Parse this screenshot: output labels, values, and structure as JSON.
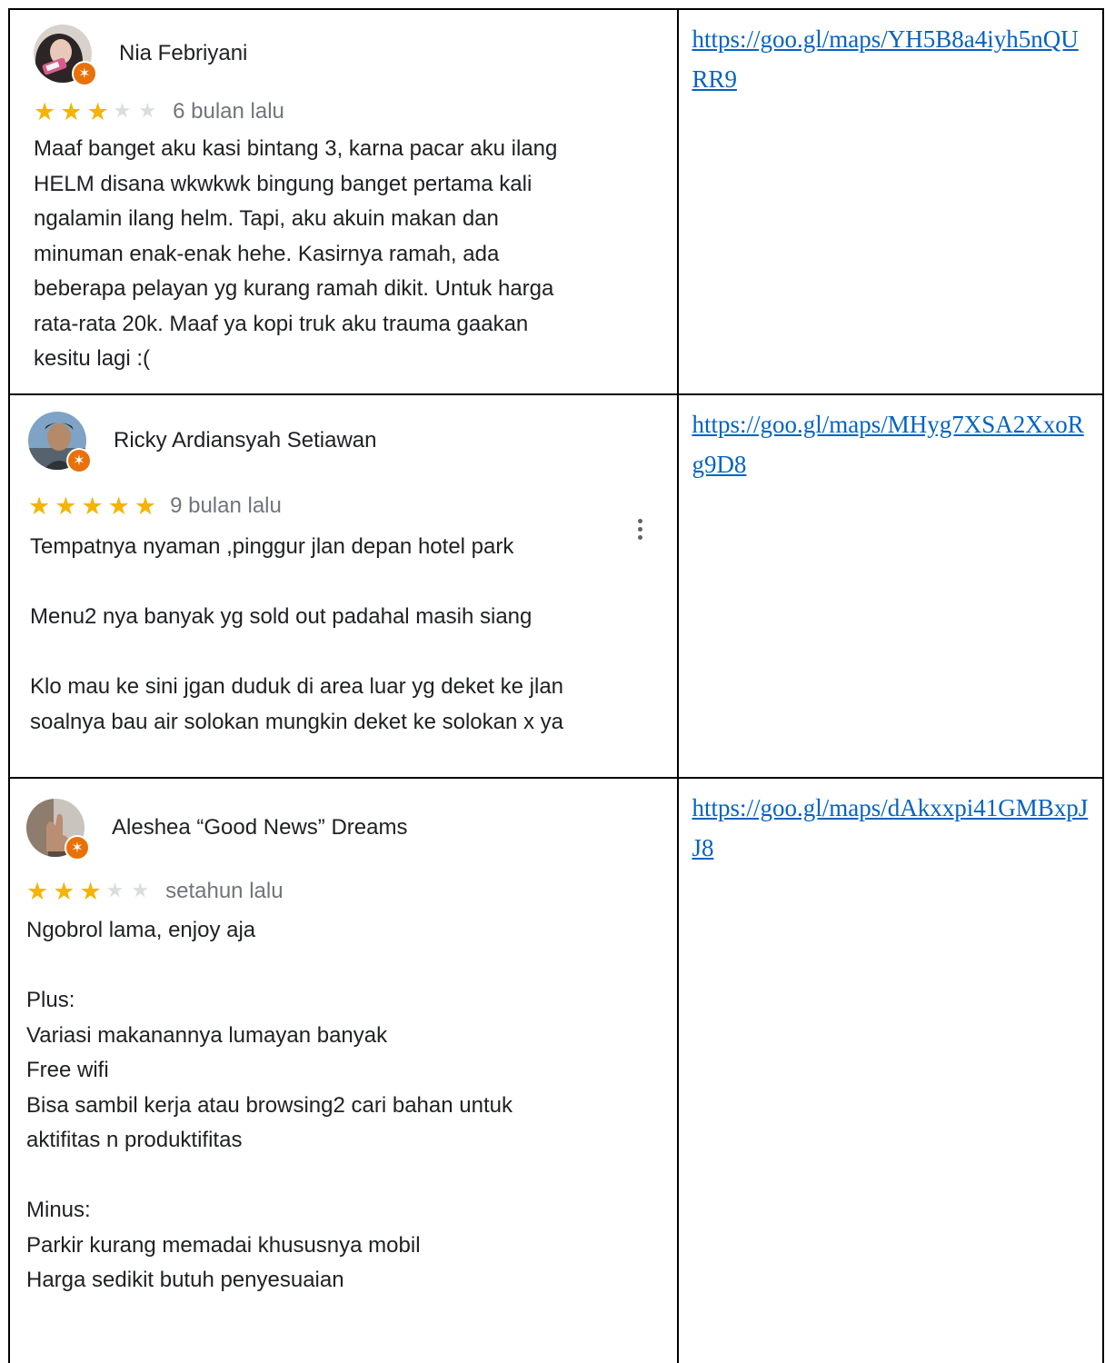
{
  "reviews": [
    {
      "name": "Nia Febriyani",
      "stars": 3,
      "date": "6 bulan lalu",
      "text": "Maaf banget aku kasi bintang 3, karna pacar aku ilang\nHELM disana wkwkwk bingung banget pertama kali\nngalamin ilang helm. Tapi, aku akuin makan dan\nminuman enak-enak hehe. Kasirnya ramah, ada\nbeberapa pelayan yg kurang ramah dikit. Untuk harga\nrata-rata 20k. Maaf ya kopi truk aku trauma gaakan\nkesitu lagi :(",
      "link": "https://goo.gl/maps/YH5B8a4iyh5nQURR9"
    },
    {
      "name": "Ricky Ardiansyah Setiawan",
      "stars": 5,
      "date": "9 bulan lalu",
      "text": "Tempatnya nyaman ,pinggur jlan depan hotel park\n\nMenu2 nya banyak yg sold out padahal masih siang\n\nKlo mau ke sini jgan duduk di area luar yg deket ke jlan\nsoalnya bau air solokan mungkin deket ke solokan x ya",
      "link": "https://goo.gl/maps/MHyg7XSA2XxoRg9D8"
    },
    {
      "name": "Aleshea “Good News” Dreams",
      "stars": 3,
      "date": "setahun lalu",
      "text": "Ngobrol lama, enjoy aja\n\nPlus:\nVariasi makanannya lumayan banyak\nFree wifi\nBisa sambil kerja atau browsing2 cari bahan untuk\naktifitas n produktifitas\n\nMinus:\nParkir kurang memadai khususnya mobil\nHarga sedikit butuh penyesuaian",
      "link": "https://goo.gl/maps/dAkxxpi41GMBxpJJ8"
    }
  ],
  "colors": {
    "star_full": "#f5b400",
    "star_empty": "#dadce0",
    "local_guide_badge": "#e8710a",
    "link": "#0563c1"
  },
  "icons": {
    "star": "★",
    "local_guide_badge": "local-guide-badge-icon",
    "more": "more-vert-icon"
  }
}
